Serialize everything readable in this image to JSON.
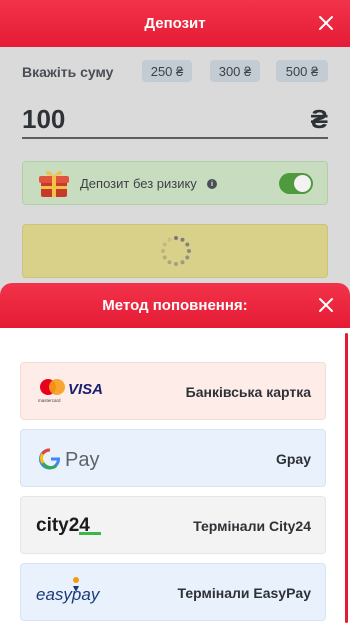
{
  "header": {
    "title": "Депозит"
  },
  "amount": {
    "label": "Вкажіть суму",
    "presets": [
      "250 ₴",
      "300 ₴",
      "500 ₴"
    ],
    "value": "100",
    "currency_symbol": "₴"
  },
  "risk_free": {
    "label": "Депозит без ризику",
    "info_icon": "i",
    "enabled": true
  },
  "submit": {
    "state": "loading"
  },
  "payment_sheet": {
    "title": "Метод поповнення:",
    "methods": [
      {
        "label": "Банківська картка",
        "logo_text": "VISA",
        "logo_subtext": "mastercard",
        "logo_icon": "mastercard-visa-icon"
      },
      {
        "label": "Gpay",
        "logo_text": "Pay",
        "logo_icon": "google-pay-icon"
      },
      {
        "label": "Термінали City24",
        "logo_text": "city24",
        "logo_icon": "city24-icon"
      },
      {
        "label": "Термінали EasyPay",
        "logo_text": "easypay",
        "logo_icon": "easypay-icon"
      }
    ]
  },
  "colors": {
    "brand_red": "#e51b35",
    "toggle_green": "#4f9a3c",
    "dim_overlay": "#dadada"
  }
}
